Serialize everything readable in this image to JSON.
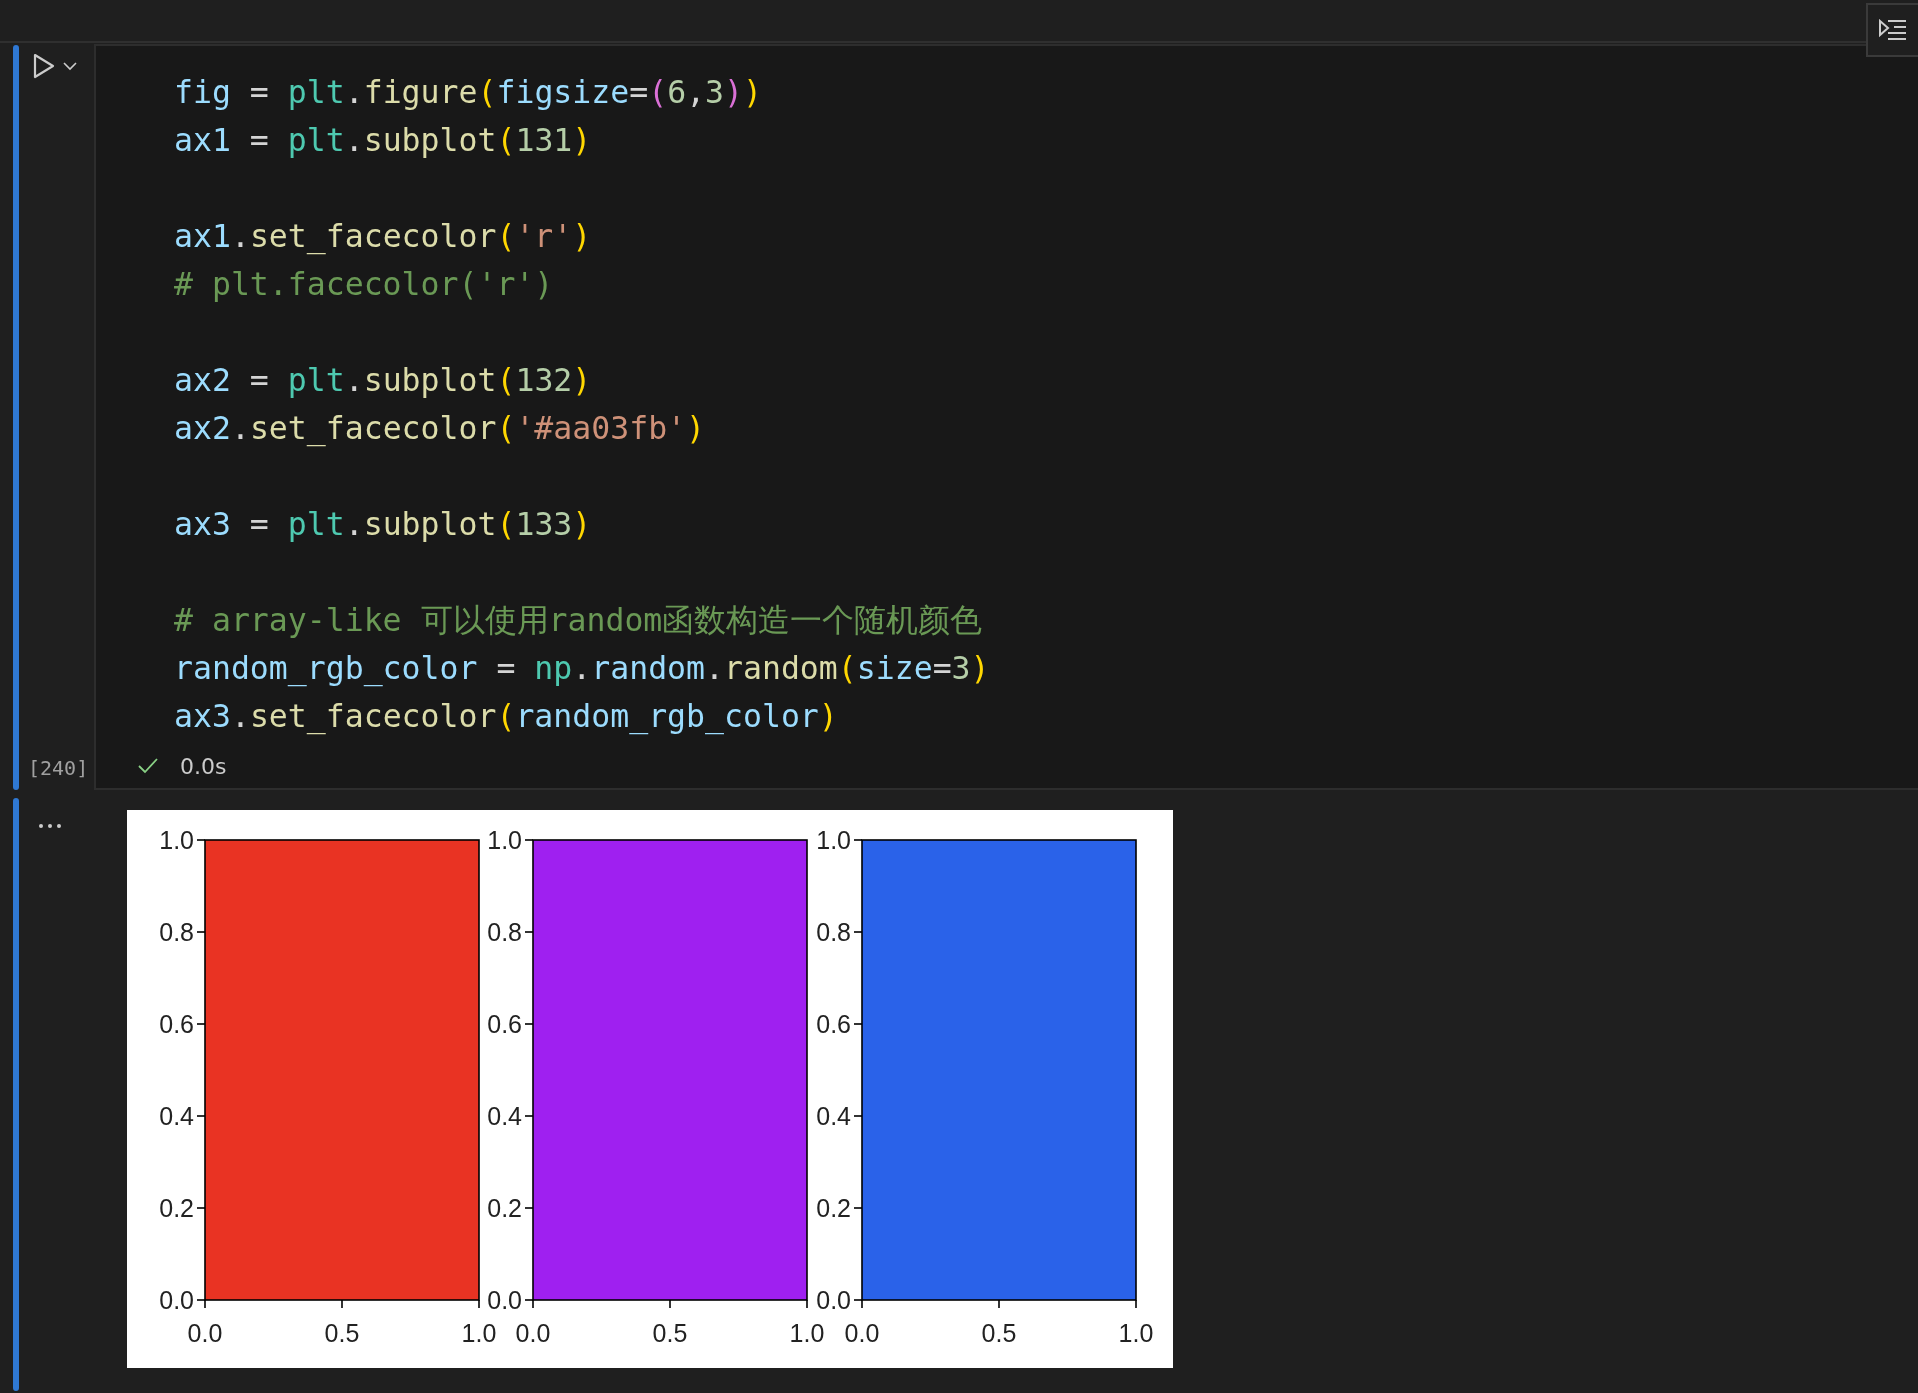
{
  "cell": {
    "execution_count": "[240]",
    "status": {
      "succeeded": true,
      "duration": "0.0s"
    },
    "lines": [
      {
        "kind": "code",
        "tokens": [
          {
            "kind": "var",
            "text": "fig"
          },
          {
            "kind": "op",
            "text": " = "
          },
          {
            "kind": "module",
            "text": "plt"
          },
          {
            "kind": "op",
            "text": "."
          },
          {
            "kind": "func",
            "text": "figure"
          },
          {
            "kind": "bracket1",
            "text": "("
          },
          {
            "kind": "var",
            "text": "figsize"
          },
          {
            "kind": "op",
            "text": "="
          },
          {
            "kind": "bracket2",
            "text": "("
          },
          {
            "kind": "num",
            "text": "6"
          },
          {
            "kind": "op",
            "text": ","
          },
          {
            "kind": "num",
            "text": "3"
          },
          {
            "kind": "bracket2",
            "text": ")"
          },
          {
            "kind": "bracket1",
            "text": ")"
          }
        ]
      },
      {
        "kind": "code",
        "tokens": [
          {
            "kind": "var",
            "text": "ax1"
          },
          {
            "kind": "op",
            "text": " = "
          },
          {
            "kind": "module",
            "text": "plt"
          },
          {
            "kind": "op",
            "text": "."
          },
          {
            "kind": "func",
            "text": "subplot"
          },
          {
            "kind": "bracket1",
            "text": "("
          },
          {
            "kind": "num",
            "text": "131"
          },
          {
            "kind": "bracket1",
            "text": ")"
          }
        ]
      },
      {
        "kind": "blank"
      },
      {
        "kind": "code",
        "tokens": [
          {
            "kind": "var",
            "text": "ax1"
          },
          {
            "kind": "op",
            "text": "."
          },
          {
            "kind": "func",
            "text": "set_facecolor"
          },
          {
            "kind": "bracket1",
            "text": "("
          },
          {
            "kind": "str",
            "text": "'r'"
          },
          {
            "kind": "bracket1",
            "text": ")"
          }
        ]
      },
      {
        "kind": "code",
        "tokens": [
          {
            "kind": "comment",
            "text": "# plt.facecolor('r')"
          }
        ]
      },
      {
        "kind": "blank"
      },
      {
        "kind": "code",
        "tokens": [
          {
            "kind": "var",
            "text": "ax2"
          },
          {
            "kind": "op",
            "text": " = "
          },
          {
            "kind": "module",
            "text": "plt"
          },
          {
            "kind": "op",
            "text": "."
          },
          {
            "kind": "func",
            "text": "subplot"
          },
          {
            "kind": "bracket1",
            "text": "("
          },
          {
            "kind": "num",
            "text": "132"
          },
          {
            "kind": "bracket1",
            "text": ")"
          }
        ]
      },
      {
        "kind": "code",
        "tokens": [
          {
            "kind": "var",
            "text": "ax2"
          },
          {
            "kind": "op",
            "text": "."
          },
          {
            "kind": "func",
            "text": "set_facecolor"
          },
          {
            "kind": "bracket1",
            "text": "("
          },
          {
            "kind": "str",
            "text": "'#aa03fb'"
          },
          {
            "kind": "bracket1",
            "text": ")"
          }
        ]
      },
      {
        "kind": "blank"
      },
      {
        "kind": "code",
        "tokens": [
          {
            "kind": "var",
            "text": "ax3"
          },
          {
            "kind": "op",
            "text": " = "
          },
          {
            "kind": "module",
            "text": "plt"
          },
          {
            "kind": "op",
            "text": "."
          },
          {
            "kind": "func",
            "text": "subplot"
          },
          {
            "kind": "bracket1",
            "text": "("
          },
          {
            "kind": "num",
            "text": "133"
          },
          {
            "kind": "bracket1",
            "text": ")"
          }
        ]
      },
      {
        "kind": "blank"
      },
      {
        "kind": "code",
        "tokens": [
          {
            "kind": "comment",
            "text": "# array-like 可以使用random函数构造一个随机颜色"
          }
        ]
      },
      {
        "kind": "code",
        "tokens": [
          {
            "kind": "var",
            "text": "random_rgb_color"
          },
          {
            "kind": "op",
            "text": " = "
          },
          {
            "kind": "module",
            "text": "np"
          },
          {
            "kind": "op",
            "text": "."
          },
          {
            "kind": "var",
            "text": "random"
          },
          {
            "kind": "op",
            "text": "."
          },
          {
            "kind": "func",
            "text": "random"
          },
          {
            "kind": "bracket1",
            "text": "("
          },
          {
            "kind": "var",
            "text": "size"
          },
          {
            "kind": "op",
            "text": "="
          },
          {
            "kind": "num",
            "text": "3"
          },
          {
            "kind": "bracket1",
            "text": ")"
          }
        ]
      },
      {
        "kind": "code",
        "tokens": [
          {
            "kind": "var",
            "text": "ax3"
          },
          {
            "kind": "op",
            "text": "."
          },
          {
            "kind": "func",
            "text": "set_facecolor"
          },
          {
            "kind": "bracket1",
            "text": "("
          },
          {
            "kind": "var",
            "text": "random_rgb_color"
          },
          {
            "kind": "bracket1",
            "text": ")"
          }
        ]
      }
    ]
  },
  "output": {
    "figure": {
      "axes": [
        {
          "color": "#e93323",
          "yticks": [
            "1.0",
            "0.8",
            "0.6",
            "0.4",
            "0.2",
            "0.0"
          ],
          "xticks": [
            "0.0",
            "0.5",
            "1.0"
          ]
        },
        {
          "color": "#9f20f0",
          "yticks": [
            "1.0",
            "0.8",
            "0.6",
            "0.4",
            "0.2",
            "0.0"
          ],
          "xticks": [
            "0.0",
            "0.5",
            "1.0"
          ]
        },
        {
          "color": "#2a62e9",
          "yticks": [
            "1.0",
            "0.8",
            "0.6",
            "0.4",
            "0.2",
            "0.0"
          ],
          "xticks": [
            "0.0",
            "0.5",
            "1.0"
          ]
        }
      ]
    }
  }
}
